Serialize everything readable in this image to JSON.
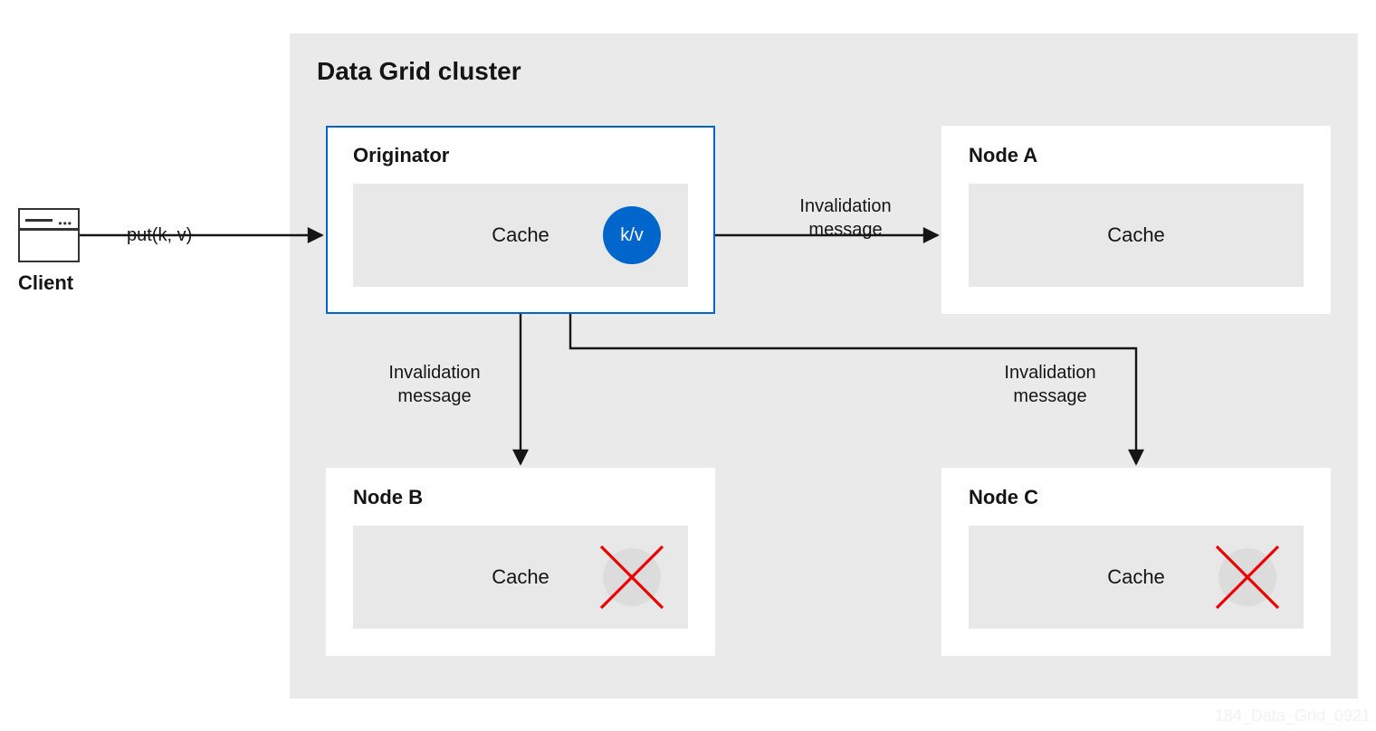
{
  "client_label": "Client",
  "put_call": "put(k, v)",
  "cluster_title": "Data Grid cluster",
  "nodes": {
    "originator": {
      "title": "Originator",
      "cache_label": "Cache",
      "kv_label": "k/v"
    },
    "a": {
      "title": "Node A",
      "cache_label": "Cache"
    },
    "b": {
      "title": "Node B",
      "cache_label": "Cache"
    },
    "c": {
      "title": "Node C",
      "cache_label": "Cache"
    }
  },
  "messages": {
    "to_a": {
      "l1": "Invalidation",
      "l2": "message"
    },
    "to_b": {
      "l1": "Invalidation",
      "l2": "message"
    },
    "to_c": {
      "l1": "Invalidation",
      "l2": "message"
    }
  },
  "watermark": "184_Data_Grid_0921",
  "colors": {
    "accent_blue": "#0066cc",
    "invalid_red": "#ee0000",
    "panel_gray": "#eaeaea"
  }
}
